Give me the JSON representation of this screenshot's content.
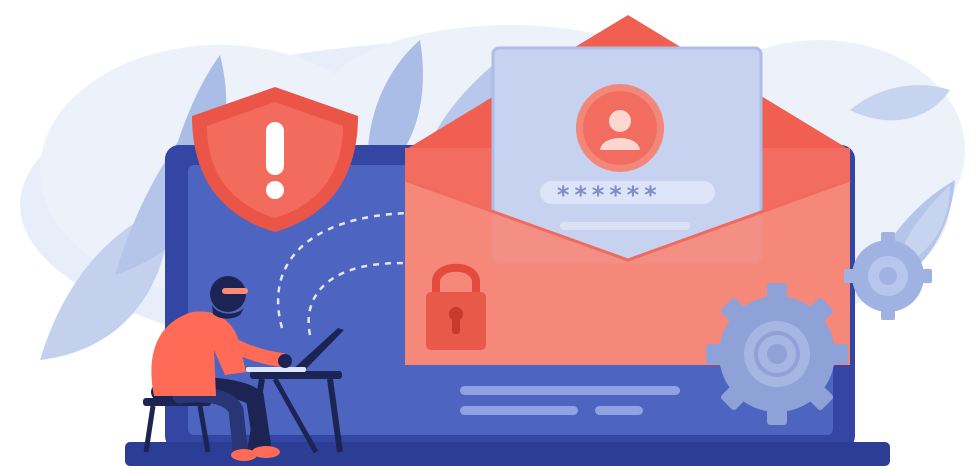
{
  "illustration": {
    "password_mask": "******",
    "icons": [
      "warning-shield-icon",
      "envelope-icon",
      "user-profile-icon",
      "padlock-icon",
      "gear-icon",
      "laptop-icon",
      "hacker-figure"
    ]
  },
  "colors": {
    "shield": "#ea5547",
    "envelope": "#f26d5f",
    "envelope_light": "#f58a7c",
    "laptop_frame": "#3346a3",
    "laptop_screen": "#4e64c1",
    "gear": "#8fa2d7",
    "leaf": "#a9bde6",
    "card": "#c7d2f1",
    "hacker_shirt": "#ff6b57",
    "hacker_dark": "#1b2452"
  }
}
